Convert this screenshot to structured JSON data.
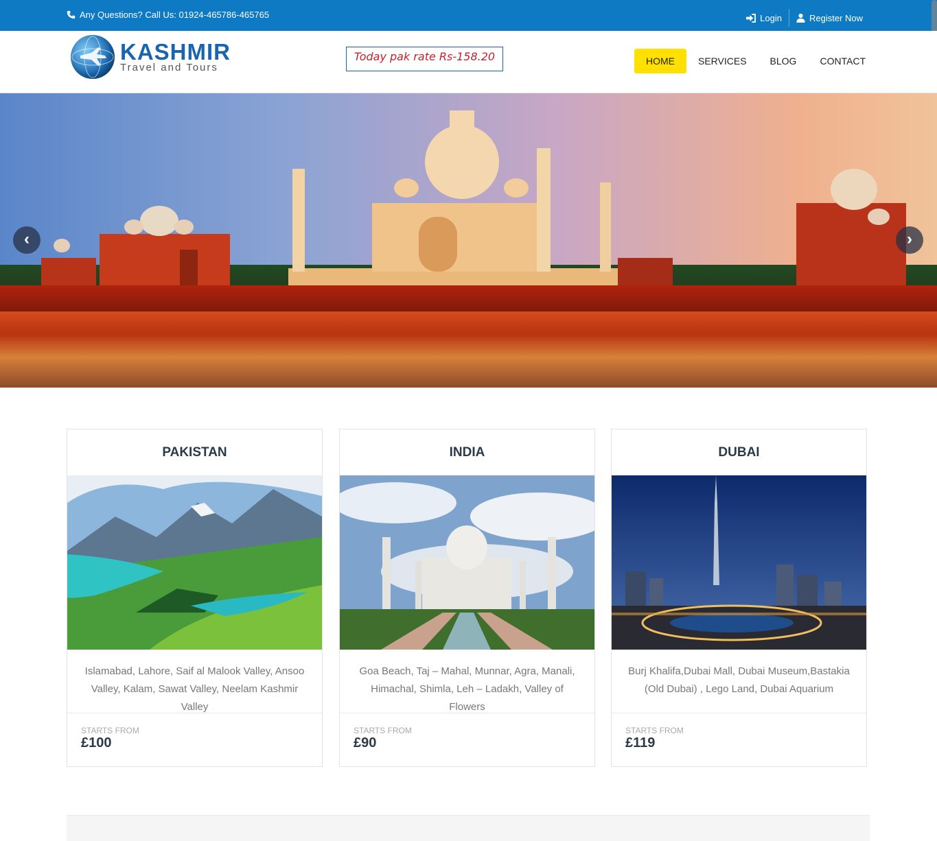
{
  "topbar": {
    "phone_text": "Any Questions? Call Us: 01924-465786-465765",
    "login_label": "Login",
    "register_label": "Register Now"
  },
  "header": {
    "logo_title": "KASHMIR",
    "logo_subtitle": "Travel and Tours",
    "rate_text": "Today pak rate Rs-158.20"
  },
  "nav": {
    "items": [
      {
        "label": "HOME"
      },
      {
        "label": "SERVICES"
      },
      {
        "label": "BLOG"
      },
      {
        "label": "CONTACT"
      }
    ]
  },
  "hero": {
    "prev_label": "‹",
    "next_label": "›"
  },
  "cards": [
    {
      "title": "PAKISTAN",
      "description": "Islamabad, Lahore, Saif al Malook Valley, Ansoo Valley, Kalam, Sawat Valley, Neelam Kashmir Valley",
      "starts_label": "STARTS FROM",
      "price": "£100"
    },
    {
      "title": "INDIA",
      "description": "Goa Beach, Taj – Mahal, Munnar, Agra, Manali, Himachal, Shimla, Leh – Ladakh, Valley of Flowers",
      "starts_label": "STARTS FROM",
      "price": "£90"
    },
    {
      "title": "DUBAI",
      "description": "Burj Khalifa,Dubai Mall, Dubai Museum,Bastakia (Old Dubai) , Lego Land, Dubai Aquarium",
      "starts_label": "STARTS FROM",
      "price": "£119"
    }
  ],
  "colors": {
    "topbar_bg": "#0e7ac4",
    "nav_active": "#ffe000",
    "rate_text": "#c8202a"
  }
}
